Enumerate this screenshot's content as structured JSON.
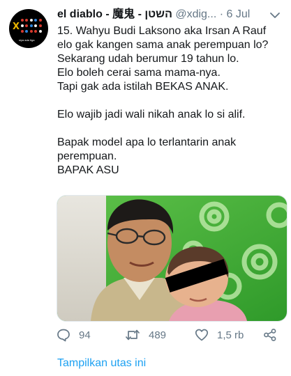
{
  "tweet": {
    "display_name": "el diablo - 魔鬼 - השטן",
    "handle": "@xdig...",
    "separator": "·",
    "date": "6 Jul",
    "text": "15. Wahyu Budi Laksono aka Irsan A Rauf\nelo gak kangen sama anak perempuan lo?\nSekarang udah berumur 19 tahun lo.\nElo boleh cerai sama mama-nya.\nTapi gak ada istilah BEKAS ANAK.\n\nElo wajib jadi wali nikah anak lo si alif.\n\nBapak model apa lo terlantarin anak\nperempuan.\nBAPAK ASU",
    "avatar_mark": "X",
    "avatar_caption": "siya ada tiga"
  },
  "actions": {
    "reply_count": "94",
    "retweet_count": "489",
    "like_count": "1,5 rb"
  },
  "thread_link": "Tampilkan utas ini",
  "icons": {
    "reply": "reply-icon",
    "retweet": "retweet-icon",
    "like": "heart-icon",
    "share": "share-icon",
    "caret": "chevron-down-icon"
  },
  "colors": {
    "link": "#1da1f2",
    "secondary_text": "#657786",
    "primary_text": "#14171a",
    "photo_background": "#3fa535"
  }
}
